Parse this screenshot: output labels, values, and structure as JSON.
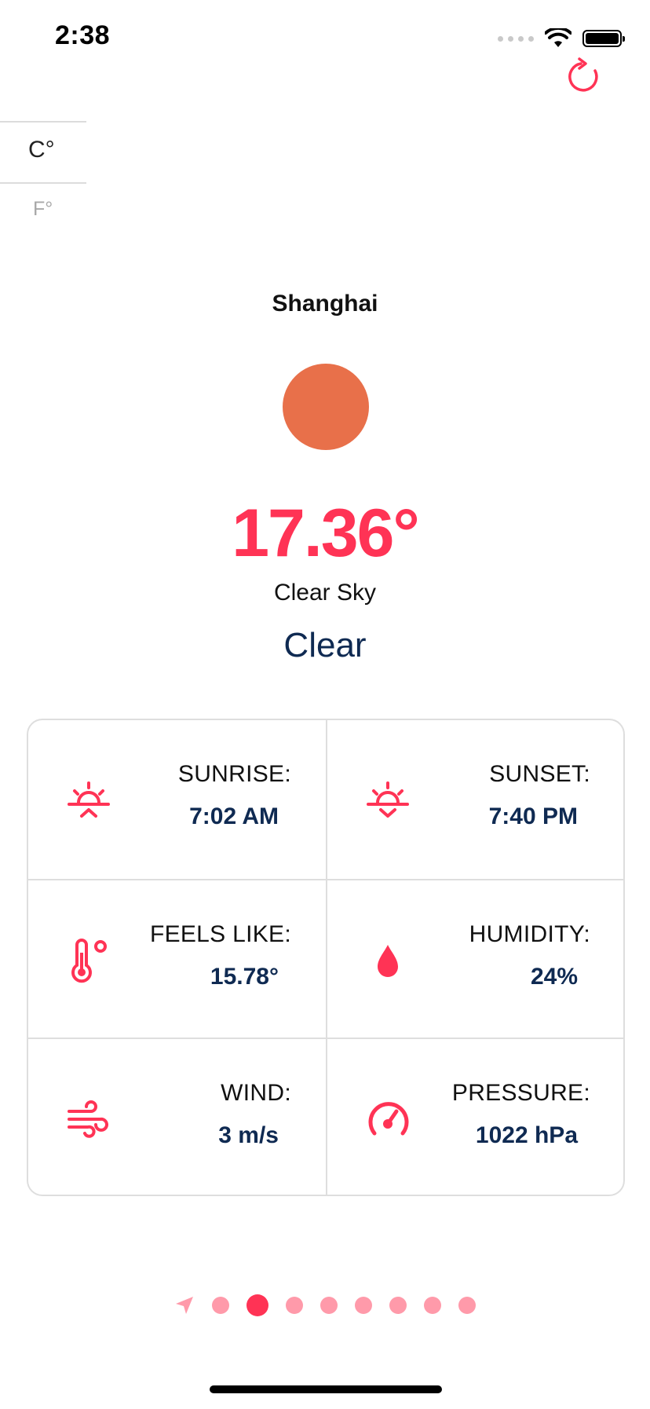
{
  "status_bar": {
    "time": "2:38"
  },
  "units": {
    "celsius": "C°",
    "fahrenheit": "F°"
  },
  "weather": {
    "city": "Shanghai",
    "temperature": "17.36°",
    "description": "Clear Sky",
    "main": "Clear"
  },
  "details": [
    {
      "label": "SUNRISE:",
      "value": "7:02 AM",
      "icon": "sunrise-icon"
    },
    {
      "label": "SUNSET:",
      "value": "7:40 PM",
      "icon": "sunset-icon"
    },
    {
      "label": "FEELS LIKE:",
      "value": "15.78°",
      "icon": "thermometer-icon"
    },
    {
      "label": "HUMIDITY:",
      "value": "24%",
      "icon": "water-drop-icon"
    },
    {
      "label": "WIND:",
      "value": "3 m/s",
      "icon": "wind-icon"
    },
    {
      "label": "PRESSURE:",
      "value": "1022 hPa",
      "icon": "gauge-icon"
    }
  ],
  "pager": {
    "total_pages": 8,
    "active_page": 2
  },
  "colors": {
    "accent": "#ff3355",
    "navy": "#0f2a52",
    "sun": "#e8704a",
    "dot_inactive": "#ff9aaa"
  }
}
